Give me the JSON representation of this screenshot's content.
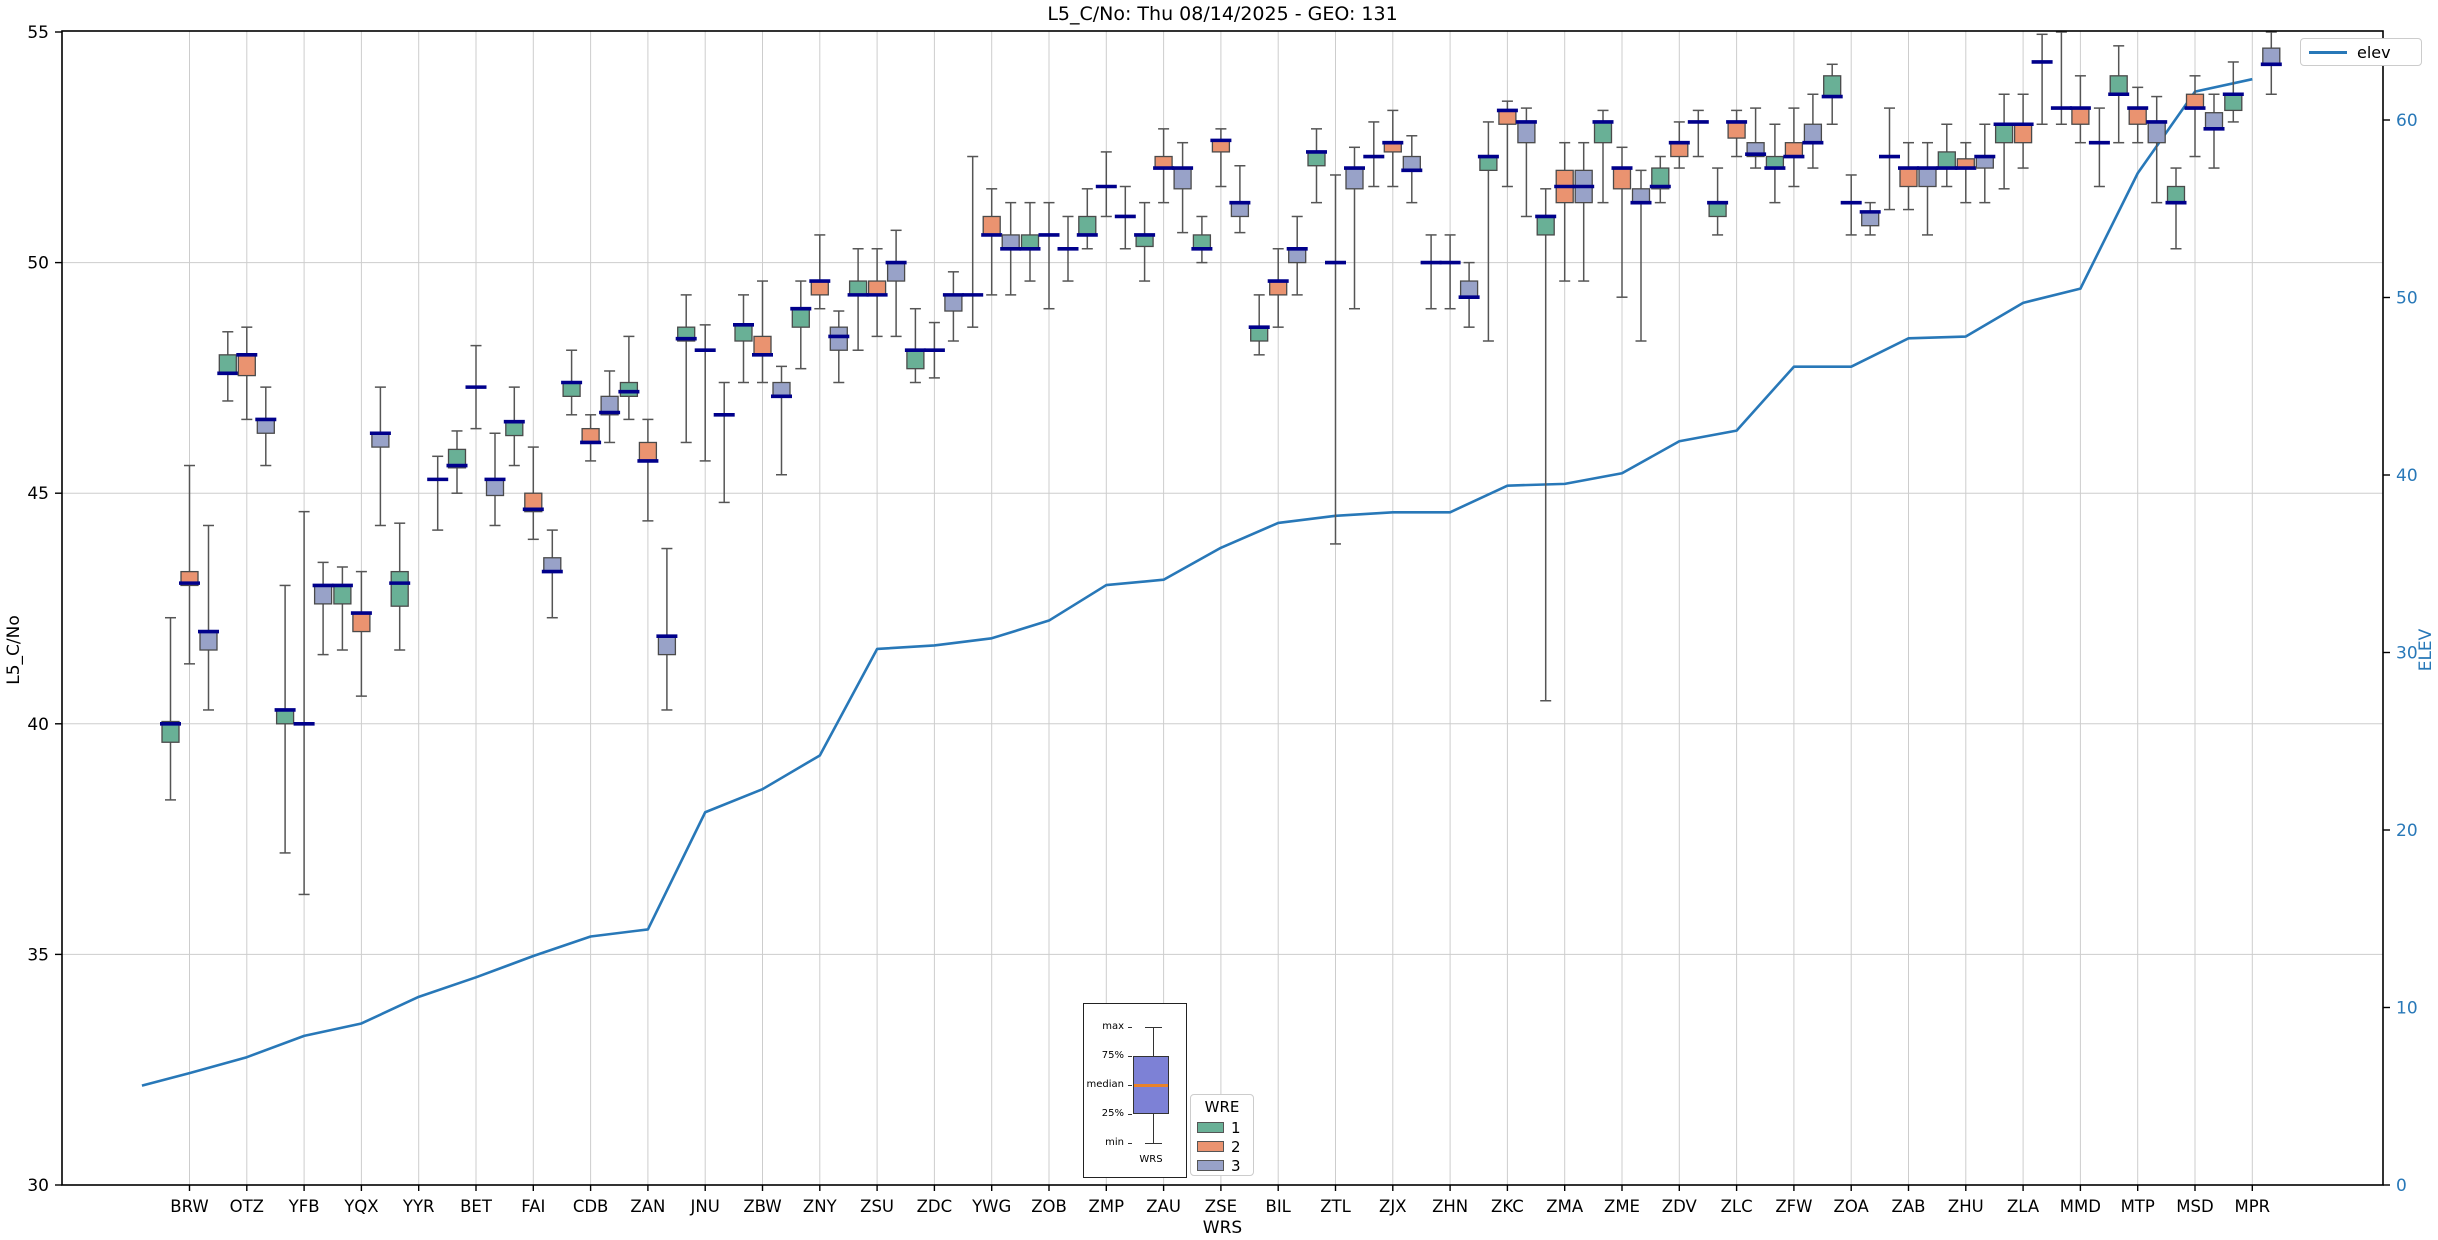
{
  "chart_data": {
    "type": "boxplot+line",
    "title": "L5_C/No: Thu 08/14/2025 - GEO: 131",
    "xlabel": "WRS",
    "ylabel_left": "L5_C/No",
    "ylabel_right": "ELEV",
    "y_left": {
      "min": 30,
      "max": 55,
      "ticks": [
        30,
        35,
        40,
        45,
        50,
        55
      ],
      "grid": [
        35,
        40,
        45,
        50
      ]
    },
    "y_right": {
      "min": 0,
      "max": 65,
      "ticks": [
        0,
        10,
        20,
        30,
        40,
        50,
        60
      ]
    },
    "colors": {
      "wre1": "#69b096",
      "wre2": "#ea9370",
      "wre3": "#98a2c8",
      "median": "#00008b",
      "whisker": "#555555",
      "elev_line": "#2878b8",
      "grid": "#cdcdcd",
      "spine": "#000000",
      "right_tick_text": "#2878b8",
      "guide_box": "#7d81d6",
      "guide_median": "#e8822a"
    },
    "line_legend": {
      "label": "elev"
    },
    "wre_legend": {
      "title": "WRE",
      "entries": [
        {
          "label": "1"
        },
        {
          "label": "2"
        },
        {
          "label": "3"
        }
      ]
    },
    "guide_labels": {
      "max": "max",
      "p75": "75%",
      "median": "median",
      "p25": "25%",
      "min": "min",
      "xlabel": "WRS"
    },
    "elev_line_start": {
      "offset": -0.83,
      "value": 5.6
    },
    "stations": [
      {
        "code": "BRW",
        "elev": 6.3,
        "wre1": {
          "med": 40.0,
          "q1": 39.6,
          "q3": 40.05,
          "lo": 38.35,
          "hi": 42.3
        },
        "wre2": {
          "med": 43.05,
          "q1": 43.0,
          "q3": 43.3,
          "lo": 41.3,
          "hi": 45.6
        },
        "wre3": {
          "med": 42.0,
          "q1": 41.6,
          "q3": 42.0,
          "lo": 40.3,
          "hi": 44.3
        }
      },
      {
        "code": "OTZ",
        "elev": 7.2,
        "wre1": {
          "med": 47.6,
          "q1": 47.6,
          "q3": 48.0,
          "lo": 47.0,
          "hi": 48.5
        },
        "wre2": {
          "med": 48.0,
          "q1": 47.55,
          "q3": 48.0,
          "lo": 46.6,
          "hi": 48.6
        },
        "wre3": {
          "med": 46.6,
          "q1": 46.3,
          "q3": 46.6,
          "lo": 45.6,
          "hi": 47.3
        }
      },
      {
        "code": "YFB",
        "elev": 8.4,
        "wre1": {
          "med": 40.3,
          "q1": 40.0,
          "q3": 40.3,
          "lo": 37.2,
          "hi": 43.0
        },
        "wre2": {
          "med": 40.0,
          "q1": 40.0,
          "q3": 40.0,
          "lo": 36.3,
          "hi": 44.6
        },
        "wre3": {
          "med": 43.0,
          "q1": 42.6,
          "q3": 43.0,
          "lo": 41.5,
          "hi": 43.5
        }
      },
      {
        "code": "YQX",
        "elev": 9.1,
        "wre1": {
          "med": 43.0,
          "q1": 42.6,
          "q3": 43.0,
          "lo": 41.6,
          "hi": 43.4
        },
        "wre2": {
          "med": 42.4,
          "q1": 42.0,
          "q3": 42.4,
          "lo": 40.6,
          "hi": 43.3
        },
        "wre3": {
          "med": 46.3,
          "q1": 46.0,
          "q3": 46.3,
          "lo": 44.3,
          "hi": 47.3
        }
      },
      {
        "code": "YYR",
        "elev": 10.6,
        "wre1": {
          "med": 43.05,
          "q1": 42.55,
          "q3": 43.3,
          "lo": 41.6,
          "hi": 44.35
        },
        "wre2": null,
        "wre3": {
          "med": 45.3,
          "q1": 45.3,
          "q3": 45.3,
          "lo": 44.2,
          "hi": 45.8
        }
      },
      {
        "code": "BET",
        "elev": 11.7,
        "wre1": {
          "med": 45.6,
          "q1": 45.55,
          "q3": 45.95,
          "lo": 45.0,
          "hi": 46.35
        },
        "wre2": {
          "med": 47.3,
          "q1": 47.3,
          "q3": 47.3,
          "lo": 46.4,
          "hi": 48.2
        },
        "wre3": {
          "med": 45.3,
          "q1": 44.95,
          "q3": 45.3,
          "lo": 44.3,
          "hi": 46.3
        }
      },
      {
        "code": "FAI",
        "elev": 12.9,
        "wre1": {
          "med": 46.55,
          "q1": 46.25,
          "q3": 46.55,
          "lo": 45.6,
          "hi": 47.3
        },
        "wre2": {
          "med": 44.65,
          "q1": 44.6,
          "q3": 45.0,
          "lo": 44.0,
          "hi": 46.0
        },
        "wre3": {
          "med": 43.3,
          "q1": 43.3,
          "q3": 43.6,
          "lo": 42.3,
          "hi": 44.2
        }
      },
      {
        "code": "CDB",
        "elev": 14.0,
        "wre1": {
          "med": 47.4,
          "q1": 47.1,
          "q3": 47.4,
          "lo": 46.7,
          "hi": 48.1
        },
        "wre2": {
          "med": 46.1,
          "q1": 46.1,
          "q3": 46.4,
          "lo": 45.7,
          "hi": 46.7
        },
        "wre3": {
          "med": 46.75,
          "q1": 46.7,
          "q3": 47.1,
          "lo": 46.1,
          "hi": 47.65
        }
      },
      {
        "code": "ZAN",
        "elev": 14.4,
        "wre1": {
          "med": 47.2,
          "q1": 47.1,
          "q3": 47.4,
          "lo": 46.6,
          "hi": 48.4
        },
        "wre2": {
          "med": 45.7,
          "q1": 45.7,
          "q3": 46.1,
          "lo": 44.4,
          "hi": 46.6
        },
        "wre3": {
          "med": 41.9,
          "q1": 41.5,
          "q3": 41.9,
          "lo": 40.3,
          "hi": 43.8
        }
      },
      {
        "code": "JNU",
        "elev": 21.0,
        "wre1": {
          "med": 48.35,
          "q1": 48.3,
          "q3": 48.6,
          "lo": 46.1,
          "hi": 49.3
        },
        "wre2": {
          "med": 48.1,
          "q1": 48.1,
          "q3": 48.1,
          "lo": 45.7,
          "hi": 48.65
        },
        "wre3": {
          "med": 46.7,
          "q1": 46.7,
          "q3": 46.7,
          "lo": 44.8,
          "hi": 47.4
        }
      },
      {
        "code": "ZBW",
        "elev": 22.3,
        "wre1": {
          "med": 48.65,
          "q1": 48.3,
          "q3": 48.65,
          "lo": 47.4,
          "hi": 49.3
        },
        "wre2": {
          "med": 48.0,
          "q1": 48.0,
          "q3": 48.4,
          "lo": 47.4,
          "hi": 49.6
        },
        "wre3": {
          "med": 47.1,
          "q1": 47.1,
          "q3": 47.4,
          "lo": 45.4,
          "hi": 47.75
        }
      },
      {
        "code": "ZNY",
        "elev": 24.2,
        "wre1": {
          "med": 49.0,
          "q1": 48.6,
          "q3": 49.0,
          "lo": 47.7,
          "hi": 49.6
        },
        "wre2": {
          "med": 49.6,
          "q1": 49.3,
          "q3": 49.6,
          "lo": 49.0,
          "hi": 50.6
        },
        "wre3": {
          "med": 48.4,
          "q1": 48.1,
          "q3": 48.6,
          "lo": 47.4,
          "hi": 48.95
        }
      },
      {
        "code": "ZSU",
        "elev": 30.2,
        "wre1": {
          "med": 49.3,
          "q1": 49.3,
          "q3": 49.6,
          "lo": 48.1,
          "hi": 50.3
        },
        "wre2": {
          "med": 49.3,
          "q1": 49.3,
          "q3": 49.6,
          "lo": 48.4,
          "hi": 50.3
        },
        "wre3": {
          "med": 50.0,
          "q1": 49.6,
          "q3": 50.0,
          "lo": 48.4,
          "hi": 50.7
        }
      },
      {
        "code": "ZDC",
        "elev": 30.4,
        "wre1": {
          "med": 48.1,
          "q1": 47.7,
          "q3": 48.1,
          "lo": 47.4,
          "hi": 49.0
        },
        "wre2": {
          "med": 48.1,
          "q1": 48.1,
          "q3": 48.1,
          "lo": 47.5,
          "hi": 48.7
        },
        "wre3": {
          "med": 49.3,
          "q1": 48.95,
          "q3": 49.3,
          "lo": 48.3,
          "hi": 49.8
        }
      },
      {
        "code": "YWG",
        "elev": 30.8,
        "wre1": {
          "med": 49.3,
          "q1": 49.3,
          "q3": 49.3,
          "lo": 48.6,
          "hi": 52.3
        },
        "wre2": {
          "med": 50.6,
          "q1": 50.6,
          "q3": 51.0,
          "lo": 49.3,
          "hi": 51.6
        },
        "wre3": {
          "med": 50.3,
          "q1": 50.3,
          "q3": 50.6,
          "lo": 49.3,
          "hi": 51.3
        }
      },
      {
        "code": "ZOB",
        "elev": 31.8,
        "wre1": {
          "med": 50.3,
          "q1": 50.3,
          "q3": 50.6,
          "lo": 49.6,
          "hi": 51.3
        },
        "wre2": {
          "med": 50.6,
          "q1": 50.6,
          "q3": 50.6,
          "lo": 49.0,
          "hi": 51.3
        },
        "wre3": {
          "med": 50.3,
          "q1": 50.3,
          "q3": 50.3,
          "lo": 49.6,
          "hi": 51.0
        }
      },
      {
        "code": "ZMP",
        "elev": 33.8,
        "wre1": {
          "med": 50.6,
          "q1": 50.6,
          "q3": 51.0,
          "lo": 50.3,
          "hi": 51.6
        },
        "wre2": {
          "med": 51.65,
          "q1": 51.65,
          "q3": 51.65,
          "lo": 51.0,
          "hi": 52.4
        },
        "wre3": {
          "med": 51.0,
          "q1": 51.0,
          "q3": 51.0,
          "lo": 50.3,
          "hi": 51.65
        }
      },
      {
        "code": "ZAU",
        "elev": 34.1,
        "wre1": {
          "med": 50.6,
          "q1": 50.35,
          "q3": 50.6,
          "lo": 49.6,
          "hi": 51.3
        },
        "wre2": {
          "med": 52.05,
          "q1": 52.05,
          "q3": 52.3,
          "lo": 51.3,
          "hi": 52.9
        },
        "wre3": {
          "med": 52.05,
          "q1": 51.6,
          "q3": 52.05,
          "lo": 50.65,
          "hi": 52.6
        }
      },
      {
        "code": "ZSE",
        "elev": 35.9,
        "wre1": {
          "med": 50.3,
          "q1": 50.3,
          "q3": 50.6,
          "lo": 50.0,
          "hi": 51.0
        },
        "wre2": {
          "med": 52.65,
          "q1": 52.4,
          "q3": 52.65,
          "lo": 51.65,
          "hi": 52.9
        },
        "wre3": {
          "med": 51.3,
          "q1": 51.0,
          "q3": 51.3,
          "lo": 50.65,
          "hi": 52.1
        }
      },
      {
        "code": "BIL",
        "elev": 37.3,
        "wre1": {
          "med": 48.6,
          "q1": 48.3,
          "q3": 48.6,
          "lo": 48.0,
          "hi": 49.3
        },
        "wre2": {
          "med": 49.6,
          "q1": 49.3,
          "q3": 49.6,
          "lo": 48.6,
          "hi": 50.3
        },
        "wre3": {
          "med": 50.3,
          "q1": 50.0,
          "q3": 50.3,
          "lo": 49.3,
          "hi": 51.0
        }
      },
      {
        "code": "ZTL",
        "elev": 37.7,
        "wre1": {
          "med": 52.4,
          "q1": 52.1,
          "q3": 52.4,
          "lo": 51.3,
          "hi": 52.9
        },
        "wre2": {
          "med": 50.0,
          "q1": 50.0,
          "q3": 50.0,
          "lo": 43.9,
          "hi": 51.9
        },
        "wre3": {
          "med": 52.05,
          "q1": 51.6,
          "q3": 52.05,
          "lo": 49.0,
          "hi": 52.5
        }
      },
      {
        "code": "ZJX",
        "elev": 37.9,
        "wre1": {
          "med": 52.3,
          "q1": 52.3,
          "q3": 52.3,
          "lo": 51.65,
          "hi": 53.05
        },
        "wre2": {
          "med": 52.6,
          "q1": 52.4,
          "q3": 52.6,
          "lo": 51.65,
          "hi": 53.3
        },
        "wre3": {
          "med": 52.0,
          "q1": 52.0,
          "q3": 52.3,
          "lo": 51.3,
          "hi": 52.75
        }
      },
      {
        "code": "ZHN",
        "elev": 37.9,
        "wre1": {
          "med": 50.0,
          "q1": 50.0,
          "q3": 50.0,
          "lo": 49.0,
          "hi": 50.6
        },
        "wre2": {
          "med": 50.0,
          "q1": 50.0,
          "q3": 50.0,
          "lo": 49.0,
          "hi": 50.6
        },
        "wre3": {
          "med": 49.25,
          "q1": 49.25,
          "q3": 49.6,
          "lo": 48.6,
          "hi": 50.0
        }
      },
      {
        "code": "ZKC",
        "elev": 39.4,
        "wre1": {
          "med": 52.3,
          "q1": 52.0,
          "q3": 52.3,
          "lo": 48.3,
          "hi": 53.05
        },
        "wre2": {
          "med": 53.3,
          "q1": 53.0,
          "q3": 53.3,
          "lo": 51.65,
          "hi": 53.5
        },
        "wre3": {
          "med": 53.05,
          "q1": 52.6,
          "q3": 53.05,
          "lo": 51.0,
          "hi": 53.35
        }
      },
      {
        "code": "ZMA",
        "elev": 39.5,
        "wre1": {
          "med": 51.0,
          "q1": 50.6,
          "q3": 51.0,
          "lo": 40.5,
          "hi": 51.6
        },
        "wre2": {
          "med": 51.65,
          "q1": 51.3,
          "q3": 52.0,
          "lo": 49.6,
          "hi": 52.6
        },
        "wre3": {
          "med": 51.65,
          "q1": 51.3,
          "q3": 52.0,
          "lo": 49.6,
          "hi": 52.6
        }
      },
      {
        "code": "ZME",
        "elev": 40.1,
        "wre1": {
          "med": 53.05,
          "q1": 52.6,
          "q3": 53.05,
          "lo": 51.3,
          "hi": 53.3
        },
        "wre2": {
          "med": 52.05,
          "q1": 51.6,
          "q3": 52.05,
          "lo": 49.25,
          "hi": 52.5
        },
        "wre3": {
          "med": 51.3,
          "q1": 51.3,
          "q3": 51.6,
          "lo": 48.3,
          "hi": 52.0
        }
      },
      {
        "code": "ZDV",
        "elev": 41.9,
        "wre1": {
          "med": 51.65,
          "q1": 51.6,
          "q3": 52.05,
          "lo": 51.3,
          "hi": 52.3
        },
        "wre2": {
          "med": 52.6,
          "q1": 52.3,
          "q3": 52.6,
          "lo": 52.05,
          "hi": 53.05
        },
        "wre3": {
          "med": 53.05,
          "q1": 53.05,
          "q3": 53.05,
          "lo": 52.3,
          "hi": 53.3
        }
      },
      {
        "code": "ZLC",
        "elev": 42.5,
        "wre1": {
          "med": 51.3,
          "q1": 51.0,
          "q3": 51.3,
          "lo": 50.6,
          "hi": 52.05
        },
        "wre2": {
          "med": 53.05,
          "q1": 52.7,
          "q3": 53.05,
          "lo": 52.3,
          "hi": 53.3
        },
        "wre3": {
          "med": 52.35,
          "q1": 52.3,
          "q3": 52.6,
          "lo": 52.05,
          "hi": 53.35
        }
      },
      {
        "code": "ZFW",
        "elev": 46.1,
        "wre1": {
          "med": 52.05,
          "q1": 52.05,
          "q3": 52.3,
          "lo": 51.3,
          "hi": 53.0
        },
        "wre2": {
          "med": 52.3,
          "q1": 52.3,
          "q3": 52.6,
          "lo": 51.65,
          "hi": 53.35
        },
        "wre3": {
          "med": 52.6,
          "q1": 52.6,
          "q3": 53.0,
          "lo": 52.05,
          "hi": 53.65
        }
      },
      {
        "code": "ZOA",
        "elev": 46.1,
        "wre1": {
          "med": 53.6,
          "q1": 53.6,
          "q3": 54.05,
          "lo": 53.0,
          "hi": 54.3
        },
        "wre2": {
          "med": 51.3,
          "q1": 51.3,
          "q3": 51.3,
          "lo": 50.6,
          "hi": 51.9
        },
        "wre3": {
          "med": 51.1,
          "q1": 50.8,
          "q3": 51.1,
          "lo": 50.6,
          "hi": 51.3
        }
      },
      {
        "code": "ZAB",
        "elev": 47.7,
        "wre1": {
          "med": 52.3,
          "q1": 52.3,
          "q3": 52.3,
          "lo": 51.15,
          "hi": 53.35
        },
        "wre2": {
          "med": 52.05,
          "q1": 51.65,
          "q3": 52.05,
          "lo": 51.15,
          "hi": 52.6
        },
        "wre3": {
          "med": 52.05,
          "q1": 51.65,
          "q3": 52.05,
          "lo": 50.6,
          "hi": 52.6
        }
      },
      {
        "code": "ZHU",
        "elev": 47.8,
        "wre1": {
          "med": 52.05,
          "q1": 52.05,
          "q3": 52.4,
          "lo": 51.65,
          "hi": 53.0
        },
        "wre2": {
          "med": 52.05,
          "q1": 52.05,
          "q3": 52.25,
          "lo": 51.3,
          "hi": 52.6
        },
        "wre3": {
          "med": 52.3,
          "q1": 52.05,
          "q3": 52.3,
          "lo": 51.3,
          "hi": 53.0
        }
      },
      {
        "code": "ZLA",
        "elev": 49.7,
        "wre1": {
          "med": 53.0,
          "q1": 52.6,
          "q3": 53.0,
          "lo": 51.6,
          "hi": 53.65
        },
        "wre2": {
          "med": 53.0,
          "q1": 52.6,
          "q3": 53.0,
          "lo": 52.05,
          "hi": 53.65
        },
        "wre3": {
          "med": 54.35,
          "q1": 54.35,
          "q3": 54.35,
          "lo": 53.0,
          "hi": 54.95
        }
      },
      {
        "code": "MMD",
        "elev": 50.5,
        "wre1": {
          "med": 53.35,
          "q1": 53.35,
          "q3": 53.35,
          "lo": 53.0,
          "hi": 55.0
        },
        "wre2": {
          "med": 53.35,
          "q1": 53.0,
          "q3": 53.35,
          "lo": 52.6,
          "hi": 54.05
        },
        "wre3": {
          "med": 52.6,
          "q1": 52.6,
          "q3": 52.6,
          "lo": 51.65,
          "hi": 53.35
        }
      },
      {
        "code": "MTP",
        "elev": 57.0,
        "wre1": {
          "med": 53.65,
          "q1": 53.65,
          "q3": 54.05,
          "lo": 52.6,
          "hi": 54.7
        },
        "wre2": {
          "med": 53.35,
          "q1": 53.0,
          "q3": 53.35,
          "lo": 52.6,
          "hi": 53.8
        },
        "wre3": {
          "med": 53.05,
          "q1": 52.6,
          "q3": 53.05,
          "lo": 51.3,
          "hi": 53.6
        }
      },
      {
        "code": "MSD",
        "elev": 61.6,
        "wre1": {
          "med": 51.3,
          "q1": 51.3,
          "q3": 51.65,
          "lo": 50.3,
          "hi": 52.05
        },
        "wre2": {
          "med": 53.35,
          "q1": 53.35,
          "q3": 53.65,
          "lo": 52.3,
          "hi": 54.05
        },
        "wre3": {
          "med": 52.9,
          "q1": 52.9,
          "q3": 53.25,
          "lo": 52.05,
          "hi": 53.65
        }
      },
      {
        "code": "MPR",
        "elev": 62.3,
        "wre1": {
          "med": 53.65,
          "q1": 53.3,
          "q3": 53.65,
          "lo": 53.05,
          "hi": 54.35
        },
        "wre2": null,
        "wre3": {
          "med": 54.3,
          "q1": 54.3,
          "q3": 54.65,
          "lo": 53.65,
          "hi": 55.0
        }
      }
    ]
  }
}
